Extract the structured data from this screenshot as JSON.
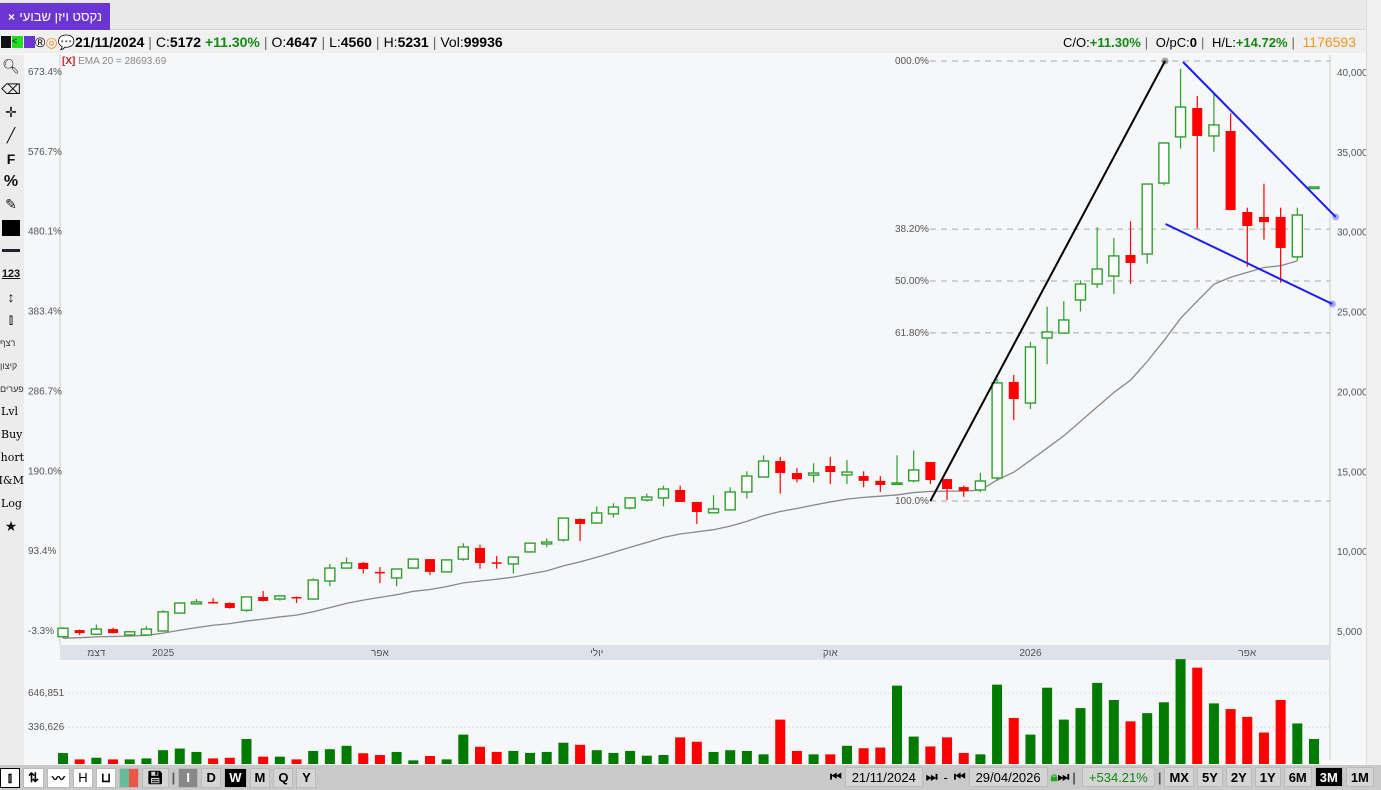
{
  "tab": {
    "title": "נקסט ויזן שבועי",
    "close": "×"
  },
  "info": {
    "date": "21/11/2024",
    "c_label": "C:",
    "close": "5172",
    "change": "+11.30%",
    "o_label": "O:",
    "open": "4647",
    "l_label": "L:",
    "low": "4560",
    "h_label": "H:",
    "high": "5231",
    "vol_label": "Vol:",
    "vol": "99936",
    "co_label": "C/O:",
    "co": "+11.30%",
    "opc_label": "O/pC:",
    "opc": "0",
    "hl_label": "H/L:",
    "hl": "+14.72%",
    "total": "1176593"
  },
  "ema_label": "EMA 20 = 28693.69",
  "ema_x": "[X]",
  "left_toolbar": {
    "f": "F",
    "pct": "%",
    "n123": "123",
    "seq": "רצף",
    "ext": "קיצון",
    "gaps": "פערים",
    "lvl": "Lvl",
    "buy": "Buy",
    "short": "Short",
    "mm": "M&M",
    "log": "Log"
  },
  "bottom": {
    "periods": [
      "I",
      "D",
      "W",
      "M",
      "Q",
      "Y"
    ],
    "active_period": "W",
    "start": "21/11/2024",
    "end": "29/04/2026",
    "sep": "-",
    "perf": "+534.21%",
    "ranges": [
      "MX",
      "5Y",
      "2Y",
      "1Y",
      "6M",
      "3M",
      "1M"
    ],
    "active_range": "3M"
  },
  "chart_data": {
    "type": "candlestick",
    "ylim": [
      5000,
      40000
    ],
    "right_ticks": [
      "40,000",
      "35,000",
      "30,000",
      "25,000",
      "20,000",
      "15,000",
      "10,000",
      "5,000"
    ],
    "right_tick_values": [
      40000,
      35000,
      30000,
      25000,
      20000,
      15000,
      10000,
      5000
    ],
    "left_ticks": [
      "673.4%",
      "576.7%",
      "480.1%",
      "383.4%",
      "286.7%",
      "190.0%",
      "93.4%",
      "-3.3%"
    ],
    "x_labels": [
      {
        "i": 2,
        "label": "דצמ"
      },
      {
        "i": 6,
        "label": "2025"
      },
      {
        "i": 19,
        "label": "אפר"
      },
      {
        "i": 32,
        "label": "יולי"
      },
      {
        "i": 46,
        "label": "אוק"
      },
      {
        "i": 58,
        "label": "2026"
      },
      {
        "i": 71,
        "label": "אפר"
      }
    ],
    "ohlc": [
      [
        4647,
        5231,
        4560,
        5172
      ],
      [
        5060,
        5100,
        4750,
        4870
      ],
      [
        4800,
        5400,
        4800,
        5120
      ],
      [
        5120,
        5200,
        4850,
        4870
      ],
      [
        4750,
        5000,
        4700,
        4950
      ],
      [
        4750,
        5300,
        4700,
        5120
      ],
      [
        5000,
        6300,
        5000,
        6200
      ],
      [
        6120,
        6800,
        6100,
        6750
      ],
      [
        6700,
        7000,
        6650,
        6820
      ],
      [
        6820,
        7050,
        6700,
        6750
      ],
      [
        6750,
        6800,
        6400,
        6440
      ],
      [
        6300,
        7150,
        6200,
        7130
      ],
      [
        7130,
        7500,
        6850,
        6880
      ],
      [
        7000,
        7250,
        6900,
        7200
      ],
      [
        7130,
        7150,
        6750,
        7080
      ],
      [
        7000,
        8300,
        7000,
        8190
      ],
      [
        8130,
        9200,
        7800,
        8940
      ],
      [
        8940,
        9600,
        8940,
        9260
      ],
      [
        9260,
        9320,
        8600,
        8880
      ],
      [
        8700,
        9000,
        8000,
        8690
      ],
      [
        8320,
        8880,
        7800,
        8880
      ],
      [
        8940,
        9500,
        8900,
        9500
      ],
      [
        9500,
        9500,
        8500,
        8700
      ],
      [
        8700,
        9450,
        8700,
        9450
      ],
      [
        9500,
        10500,
        9400,
        10260
      ],
      [
        10200,
        10400,
        8900,
        9260
      ],
      [
        9300,
        9700,
        8900,
        9250
      ],
      [
        9200,
        9630,
        8600,
        9630
      ],
      [
        9950,
        10500,
        9900,
        10500
      ],
      [
        10450,
        10800,
        10250,
        10570
      ],
      [
        10700,
        12100,
        10600,
        12070
      ],
      [
        12010,
        12050,
        10630,
        11700
      ],
      [
        11760,
        12800,
        11700,
        12390
      ],
      [
        12330,
        13000,
        12100,
        12760
      ],
      [
        12700,
        13330,
        12600,
        13330
      ],
      [
        13200,
        13600,
        13100,
        13390
      ],
      [
        13330,
        14100,
        12800,
        13890
      ],
      [
        13830,
        14100,
        13080,
        13080
      ],
      [
        13080,
        13080,
        11700,
        12450
      ],
      [
        12400,
        13500,
        12400,
        12640
      ],
      [
        12580,
        14000,
        12580,
        13700
      ],
      [
        13700,
        15000,
        13300,
        14700
      ],
      [
        14640,
        16000,
        14640,
        15640
      ],
      [
        15640,
        15900,
        13600,
        14890
      ],
      [
        14890,
        15200,
        14300,
        14500
      ],
      [
        14760,
        15500,
        14300,
        14890
      ],
      [
        15330,
        15900,
        14200,
        14950
      ],
      [
        14770,
        15700,
        14200,
        14950
      ],
      [
        14700,
        15000,
        14000,
        14400
      ],
      [
        14400,
        14700,
        13700,
        14140
      ],
      [
        14200,
        16000,
        14200,
        14270
      ],
      [
        14400,
        16300,
        14300,
        15080
      ],
      [
        15580,
        15580,
        14200,
        14450
      ],
      [
        14510,
        14510,
        13200,
        13890
      ],
      [
        14010,
        14100,
        13400,
        13760
      ],
      [
        13830,
        14900,
        13700,
        14390
      ],
      [
        14580,
        20800,
        14400,
        20530
      ],
      [
        20590,
        21030,
        18200,
        19520
      ],
      [
        19270,
        23100,
        18900,
        22780
      ],
      [
        23340,
        25300,
        21700,
        23720
      ],
      [
        23650,
        25650,
        23650,
        24470
      ],
      [
        25720,
        26950,
        25000,
        26720
      ],
      [
        26720,
        30270,
        26470,
        27660
      ],
      [
        27220,
        29600,
        26100,
        28480
      ],
      [
        28540,
        30650,
        26720,
        28040
      ],
      [
        28600,
        32980,
        28000,
        32980
      ],
      [
        33040,
        35550,
        32900,
        35550
      ],
      [
        35930,
        40200,
        35200,
        37800
      ],
      [
        37740,
        38500,
        30200,
        35990
      ],
      [
        35990,
        38700,
        35000,
        36680
      ],
      [
        36300,
        37400,
        31350,
        31350
      ],
      [
        31230,
        31500,
        27800,
        30350
      ],
      [
        30920,
        33000,
        29500,
        30600
      ],
      [
        30920,
        31500,
        26800,
        28980
      ],
      [
        28420,
        31500,
        28200,
        31040
      ],
      [
        32700,
        32800,
        32700,
        32800
      ]
    ],
    "volume_ticks": [
      "646,851",
      "336,626"
    ],
    "volume_tick_values": [
      646851,
      336626
    ],
    "volume": [
      99936,
      42000,
      57000,
      42000,
      42000,
      51000,
      126000,
      141000,
      110000,
      51000,
      57000,
      228000,
      67000,
      67000,
      42000,
      119000,
      135000,
      166000,
      98000,
      82000,
      110000,
      33000,
      73000,
      42000,
      268000,
      157000,
      110000,
      119000,
      101000,
      110000,
      194000,
      175000,
      126000,
      101000,
      119000,
      76000,
      82000,
      243000,
      203000,
      110000,
      126000,
      119000,
      88000,
      405000,
      119000,
      88000,
      88000,
      166000,
      144000,
      150000,
      715000,
      250000,
      160000,
      243000,
      101000,
      88000,
      724000,
      420000,
      268000,
      696000,
      405000,
      510000,
      740000,
      584000,
      389000,
      464000,
      563000,
      957000,
      879000,
      553000,
      501000,
      430000,
      287000,
      584000,
      370000,
      228000
    ],
    "ema_period": 20,
    "fib": {
      "high": 40680,
      "low": 13140,
      "levels": [
        {
          "r": 0,
          "label": "000.0%"
        },
        {
          "r": 0.382,
          "label": "38.20%"
        },
        {
          "r": 0.5,
          "label": "50.00%"
        },
        {
          "r": 0.618,
          "label": "61.80%"
        },
        {
          "r": 1,
          "label": "100.0%"
        }
      ]
    },
    "trendlines": [
      {
        "color": "#000000",
        "from": [
          52,
          13140
        ],
        "to": [
          66.07,
          40680
        ]
      },
      {
        "color": "#1a1aff",
        "from": [
          67.15,
          40620
        ],
        "to": [
          76.3,
          30920
        ]
      },
      {
        "color": "#1a1aff",
        "from": [
          66.1,
          30480
        ],
        "to": [
          76.1,
          25470
        ]
      }
    ],
    "colors": {
      "up": "#2e9e2e",
      "down": "#ff0000",
      "vol_up": "#007a00",
      "ema": "#888888"
    }
  }
}
